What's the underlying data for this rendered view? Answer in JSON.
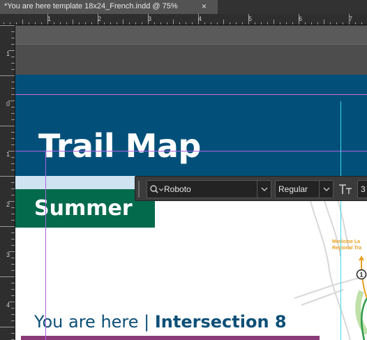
{
  "document_tab": {
    "title": "*You are here template 18x24_French.indd @ 75%",
    "close_glyph": "×"
  },
  "rulers": {
    "top_numbers": [
      "1",
      "2",
      "3",
      "4",
      "5",
      "6",
      "7"
    ],
    "left_numbers": [
      "1",
      "0",
      "1",
      "2",
      "3",
      "4"
    ]
  },
  "page": {
    "title": "Trail Map",
    "season": "Summer",
    "you_are_here_prefix": "You are here | ",
    "intersection": "Intersection 8",
    "map_label_line1": "Medicine La",
    "map_label_line2": "Regional Tra",
    "map_marker": "1",
    "colors": {
      "header_blue": "#02507a",
      "season_green": "#036a4c",
      "heading_blue": "#0c4f77",
      "accent_purple": "#8b3a78",
      "map_label_orange": "#e8a020"
    }
  },
  "control_bar": {
    "font_family": "Roboto",
    "font_style": "Regular",
    "font_size": "3",
    "icons": [
      "search-icon",
      "chevron-down-icon",
      "font-size-icon"
    ]
  }
}
